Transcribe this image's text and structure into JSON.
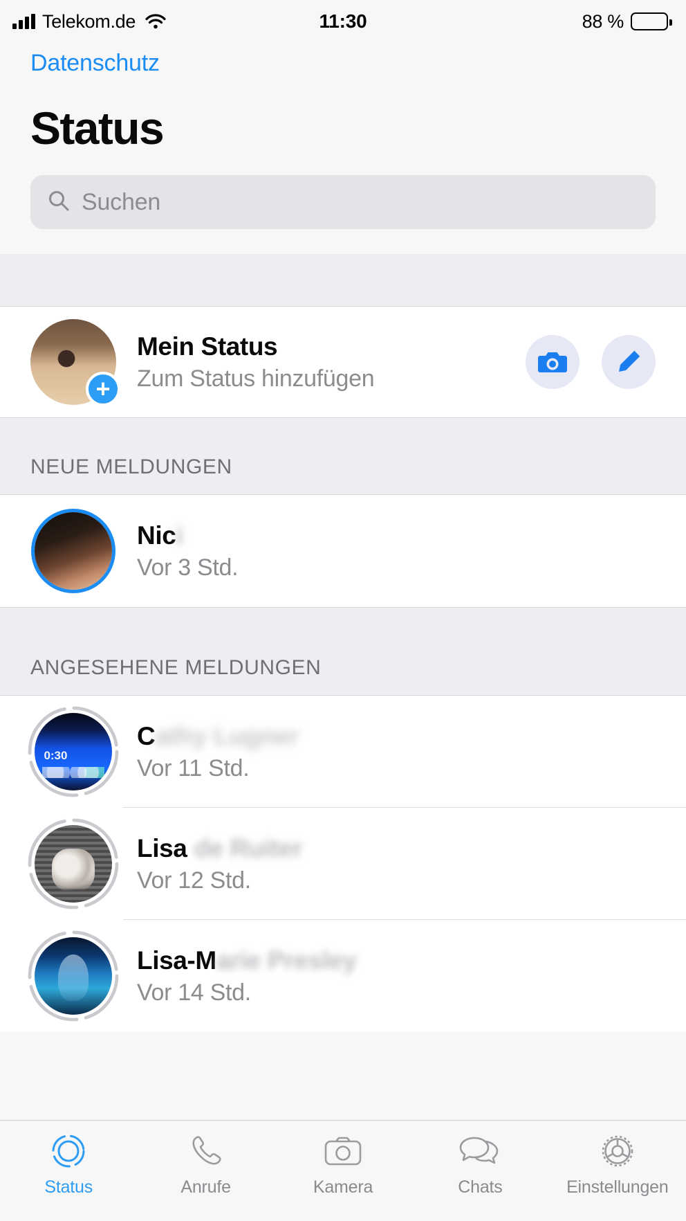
{
  "status_bar": {
    "carrier": "Telekom.de",
    "time": "11:30",
    "battery_percent": "88 %",
    "signal_icon": "cellular-bars-icon",
    "wifi_icon": "wifi-icon",
    "battery_icon": "battery-icon"
  },
  "header": {
    "back_label": "Datenschutz",
    "title": "Status"
  },
  "search": {
    "placeholder": "Suchen",
    "value": "",
    "icon": "search-icon"
  },
  "my_status": {
    "title": "Mein Status",
    "subtitle": "Zum Status hinzufügen",
    "add_badge": "+",
    "avatar_name": "my-status-avatar",
    "actions": [
      {
        "name": "camera-button",
        "icon": "camera-icon"
      },
      {
        "name": "compose-button",
        "icon": "pencil-icon"
      }
    ]
  },
  "sections": [
    {
      "header": "NEUE MELDUNGEN",
      "items": [
        {
          "name_visible": "Nic",
          "name_blurred": "i",
          "time": "Vor 3 Std.",
          "seen": false
        }
      ]
    },
    {
      "header": "ANGESEHENE MELDUNGEN",
      "items": [
        {
          "name_visible": "C",
          "name_blurred": "athy Lugner",
          "time": "Vor 11 Std.",
          "seen": true
        },
        {
          "name_visible": "Lisa",
          "name_blurred": " de Ruiter",
          "time": "Vor 12 Std.",
          "seen": true
        },
        {
          "name_visible": "Lisa-M",
          "name_blurred": "arie Presley",
          "time": "Vor 14 Std.",
          "seen": true
        }
      ]
    }
  ],
  "avatar_overlay": {
    "cathy_timestamp": "0:30"
  },
  "tabbar": {
    "tabs": [
      {
        "label": "Status",
        "icon": "status-rings-icon",
        "active": true
      },
      {
        "label": "Anrufe",
        "icon": "phone-icon",
        "active": false
      },
      {
        "label": "Kamera",
        "icon": "camera-outline-icon",
        "active": false
      },
      {
        "label": "Chats",
        "icon": "chat-bubbles-icon",
        "active": false
      },
      {
        "label": "Einstellungen",
        "icon": "gear-icon",
        "active": false
      }
    ]
  },
  "colors": {
    "accent_blue": "#1b8cf3",
    "tab_active": "#2d9cf5",
    "section_bg": "#eeeef2",
    "action_bg": "#e7e8f6"
  }
}
